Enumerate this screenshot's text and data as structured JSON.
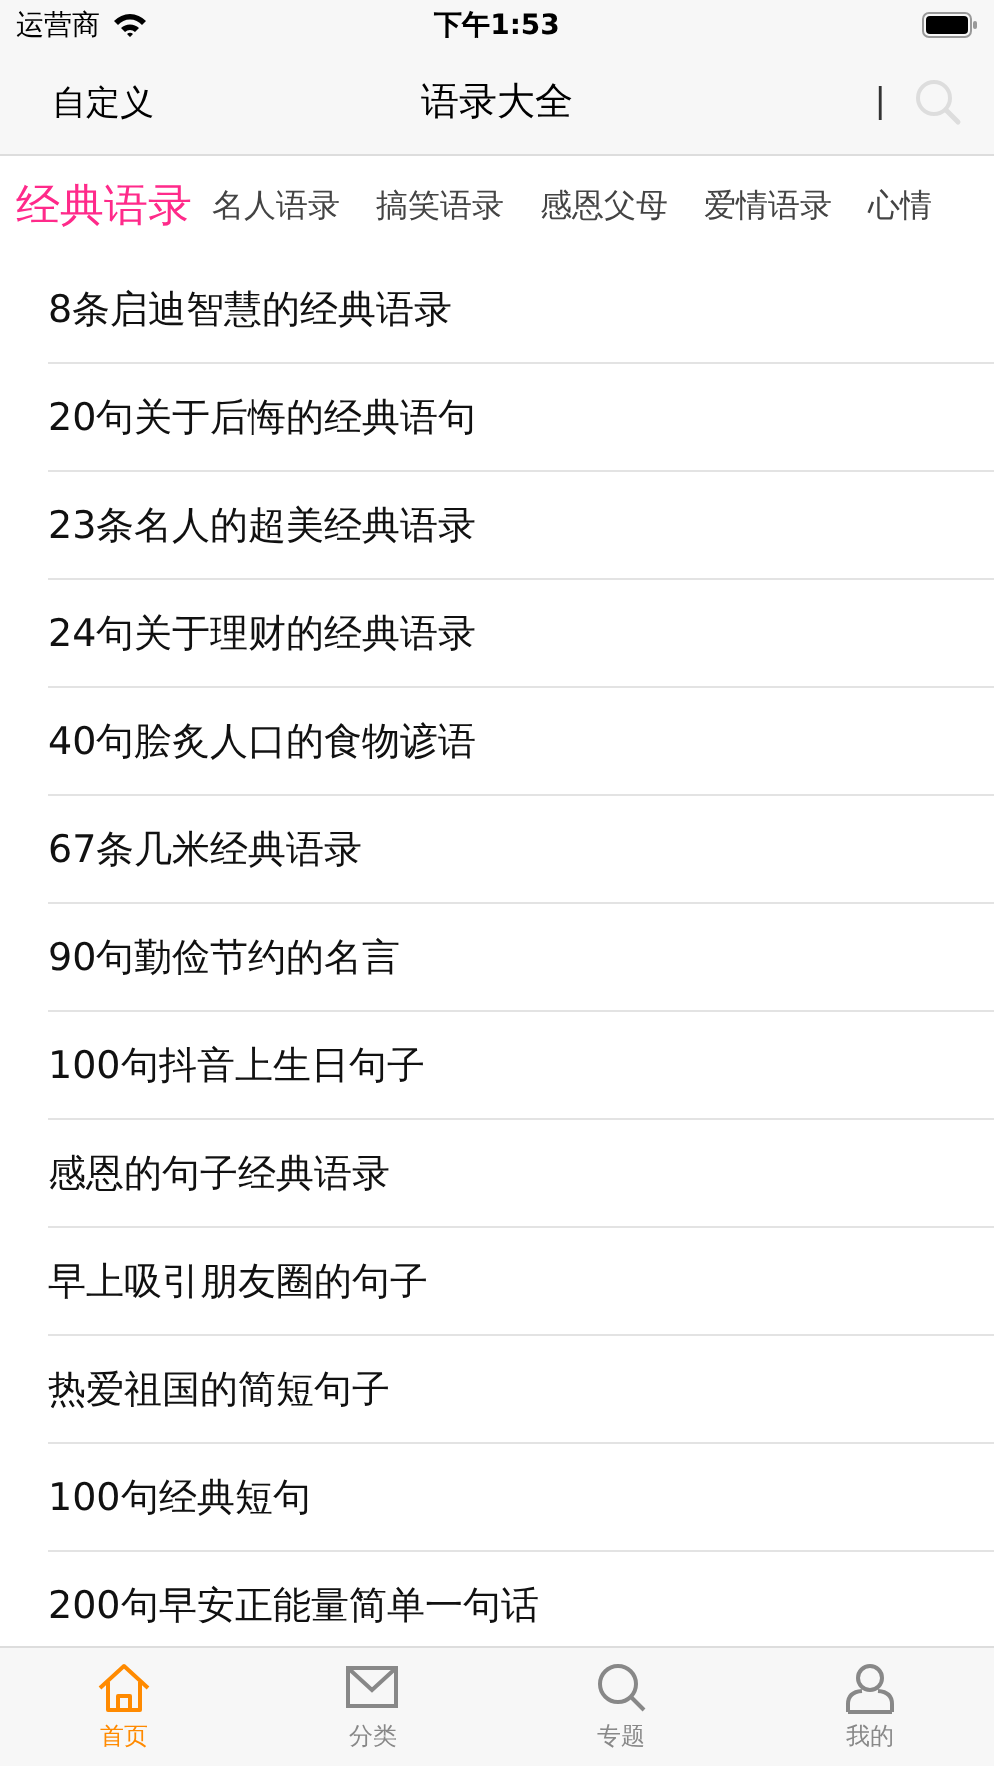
{
  "status_bar": {
    "carrier": "运营商",
    "time": "下午1:53"
  },
  "nav_bar": {
    "left": "自定义",
    "title": "语录大全",
    "divider": "|"
  },
  "tabs": [
    {
      "label": "经典语录",
      "selected": true
    },
    {
      "label": "名人语录",
      "selected": false
    },
    {
      "label": "搞笑语录",
      "selected": false
    },
    {
      "label": "感恩父母",
      "selected": false
    },
    {
      "label": "爱情语录",
      "selected": false
    },
    {
      "label": "心情",
      "selected": false
    }
  ],
  "list": [
    "8条启迪智慧的经典语录",
    "20句关于后悔的经典语句",
    "23条名人的超美经典语录",
    "24句关于理财的经典语录",
    "40句脍炙人口的食物谚语",
    "67条几米经典语录",
    "90句勤俭节约的名言",
    "100句抖音上生日句子",
    "感恩的句子经典语录",
    "早上吸引朋友圈的句子",
    "热爱祖国的简短句子",
    "100句经典短句",
    "200句早安正能量简单一句话"
  ],
  "tab_bar": [
    {
      "label": "首页",
      "kind": "home",
      "selected": true
    },
    {
      "label": "分类",
      "kind": "mail",
      "selected": false
    },
    {
      "label": "专题",
      "kind": "search",
      "selected": false
    },
    {
      "label": "我的",
      "kind": "person",
      "selected": false
    }
  ]
}
